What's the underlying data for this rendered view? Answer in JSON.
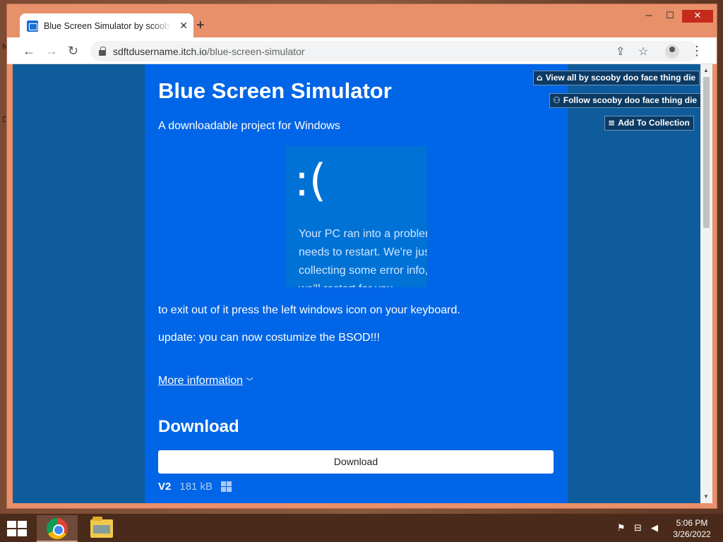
{
  "desktop": {
    "edge_text_top": "M",
    "edge_text_mid": "D"
  },
  "browser": {
    "tab_title": "Blue Screen Simulator by scooby doo face thing die",
    "tab_close": "✕",
    "new_tab": "+",
    "window_controls": {
      "minimize": "─",
      "maximize": "☐",
      "close": "✕"
    },
    "nav": {
      "back": "←",
      "forward": "→",
      "reload": "↻"
    },
    "url_host": "sdftdusername.itch.io",
    "url_path": "/blue-screen-simulator",
    "share_icon": "⇪",
    "star_icon": "☆",
    "menu": "⋮"
  },
  "page": {
    "title": "Blue Screen Simulator",
    "subtitle": "A downloadable project for Windows",
    "bsod": {
      "face": ":(",
      "text": "Your PC ran into a problem and needs to restart. We're just collecting some error info, and then we'll restart for you."
    },
    "paragraph_1": "to exit out of it press the left windows icon on your keyboard.",
    "paragraph_2": "update: you can now costumize the BSOD!!!",
    "more_info": "More information",
    "download_heading": "Download",
    "download_button": "Download",
    "file": {
      "name": "V2",
      "size": "181 kB"
    },
    "user_tools": {
      "view_all": "View all by scooby doo face thing die",
      "follow": "Follow scooby doo face thing die",
      "add_collection": "Add To Collection"
    }
  },
  "taskbar": {
    "time": "5:06 PM",
    "date": "3/26/2022"
  }
}
